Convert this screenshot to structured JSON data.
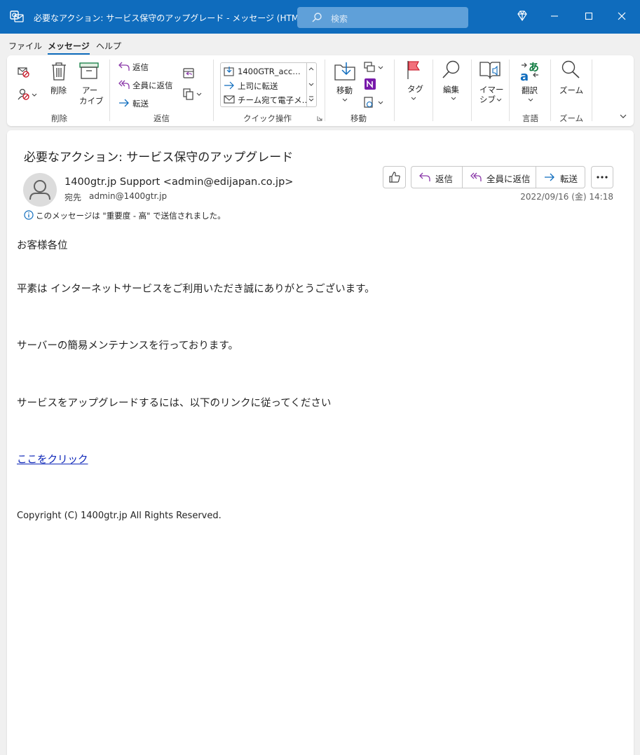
{
  "window": {
    "title": "必要なアクション: サービス保守のアップグレード  -  メッセージ (HTML 形式)",
    "search_placeholder": "検索",
    "accent_color": "#0f6cbd"
  },
  "menu": {
    "items": [
      "ファイル",
      "メッセージ",
      "ヘルプ"
    ],
    "active": "メッセージ"
  },
  "ribbon": {
    "delete_group": {
      "label": "削除",
      "delete": "削除",
      "archive_line1": "アー",
      "archive_line2": "カイブ"
    },
    "reply_group": {
      "label": "返信",
      "reply": "返信",
      "reply_all": "全員に返信",
      "forward": "転送"
    },
    "quick_group": {
      "label": "クイック操作",
      "items": [
        "1400GTR_acc…",
        "上司に転送",
        "チーム宛て電子メ…"
      ]
    },
    "move_group": {
      "label": "移動",
      "move": "移動"
    },
    "tags_group": {
      "tag": "タグ"
    },
    "edit_group": {
      "edit": "編集"
    },
    "reader_group": {
      "immersive_line1": "イマー",
      "immersive_line2": "シブ"
    },
    "language_group": {
      "label": "言語",
      "translate": "翻訳"
    },
    "zoom_group": {
      "label": "ズーム",
      "zoom": "ズーム"
    }
  },
  "message": {
    "subject": "必要なアクション: サービス保守のアップグレード",
    "sender": "1400gtr.jp Support <admin@edijapan.co.jp>",
    "to_label": "宛先",
    "to_value": "admin@1400gtr.jp",
    "importance_notice": "このメッセージは \"重要度 - 高\" で送信されました。",
    "date": "2022/09/16 (金) 14:18",
    "actions": {
      "reply": "返信",
      "reply_all": "全員に返信",
      "forward": "転送"
    },
    "body": {
      "greeting": "お客様各位",
      "line1": "平素は インターネットサービスをご利用いただき誠にありがとうございます。",
      "line2": "サーバーの簡易メンテナンスを行っております。",
      "line3": "サービスをアップグレードするには、以下のリンクに従ってください",
      "link": "ここをクリック",
      "copyright": "Copyright (C) 1400gtr.jp All Rights Reserved."
    }
  }
}
